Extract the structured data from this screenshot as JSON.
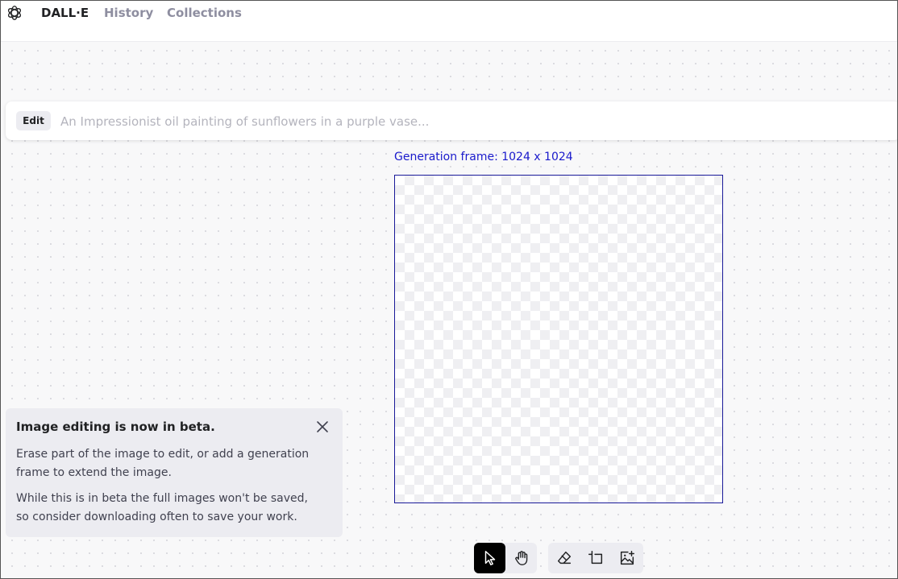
{
  "nav": {
    "brand": "DALL·E",
    "history": "History",
    "collections": "Collections"
  },
  "prompt": {
    "chip": "Edit",
    "value": "",
    "placeholder": "An Impressionist oil painting of sunflowers in a purple vase..."
  },
  "canvas": {
    "frame_label": "Generation frame: 1024 x 1024"
  },
  "beta_notice": {
    "title": "Image editing is now in beta.",
    "paragraph_1": "Erase part of the image to edit, or add a generation frame to extend the image.",
    "paragraph_2": "While this is in beta the full images won't be saved, so consider downloading often to save your work."
  },
  "toolbar": {
    "tools": [
      {
        "icon": "select-pointer-icon",
        "active": true
      },
      {
        "icon": "pan-hand-icon",
        "active": false
      },
      {
        "icon": "eraser-icon",
        "active": false
      },
      {
        "icon": "add-generation-frame-icon",
        "active": false
      },
      {
        "icon": "upload-image-icon",
        "active": false
      }
    ]
  },
  "colors": {
    "frame_accent": "#1a1acc",
    "active_tool": "#000000",
    "card_bg": "#ececf1"
  }
}
